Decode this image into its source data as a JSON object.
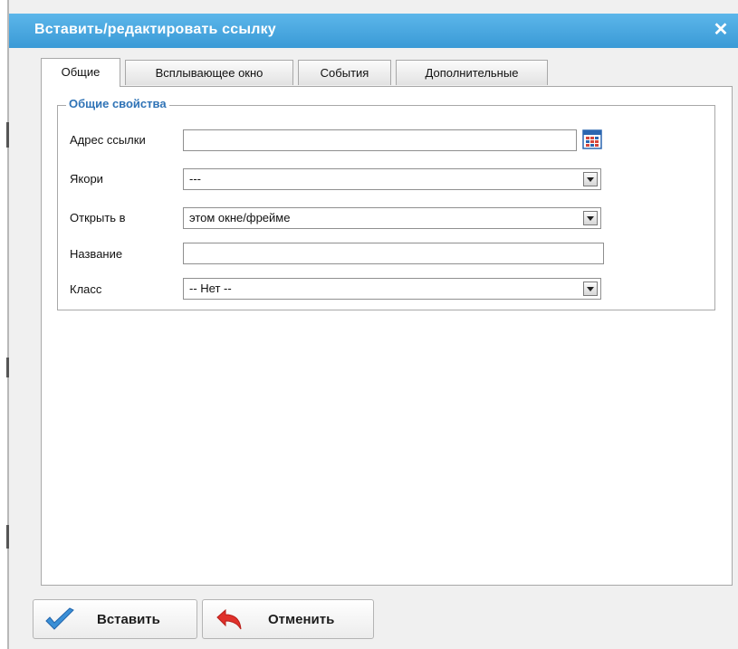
{
  "dialog": {
    "title": "Вставить/редактировать ссылку",
    "close_glyph": "✕"
  },
  "tabs": [
    {
      "label": "Общие",
      "active": true
    },
    {
      "label": "Всплывающее окно",
      "active": false
    },
    {
      "label": "События",
      "active": false
    },
    {
      "label": "Дополнительные",
      "active": false
    }
  ],
  "general": {
    "legend": "Общие свойства",
    "link_url": {
      "label": "Адрес ссылки",
      "value": "",
      "browse_icon": "calendar-grid-icon"
    },
    "anchors": {
      "label": "Якори",
      "value": "---"
    },
    "target": {
      "label": "Открыть в",
      "value": "этом окне/фрейме"
    },
    "title": {
      "label": "Название",
      "value": ""
    },
    "class": {
      "label": "Класс",
      "value": "-- Нет --"
    }
  },
  "buttons": {
    "insert": {
      "label": "Вставить",
      "icon": "checkmark-icon",
      "color": "#3a8fd6"
    },
    "cancel": {
      "label": "Отменить",
      "icon": "undo-arrow-icon",
      "color": "#e0312b"
    }
  },
  "colors": {
    "titlebar": "#3a9ad6",
    "legend": "#2f73b6",
    "dialog_bg": "#f0f0f0"
  }
}
